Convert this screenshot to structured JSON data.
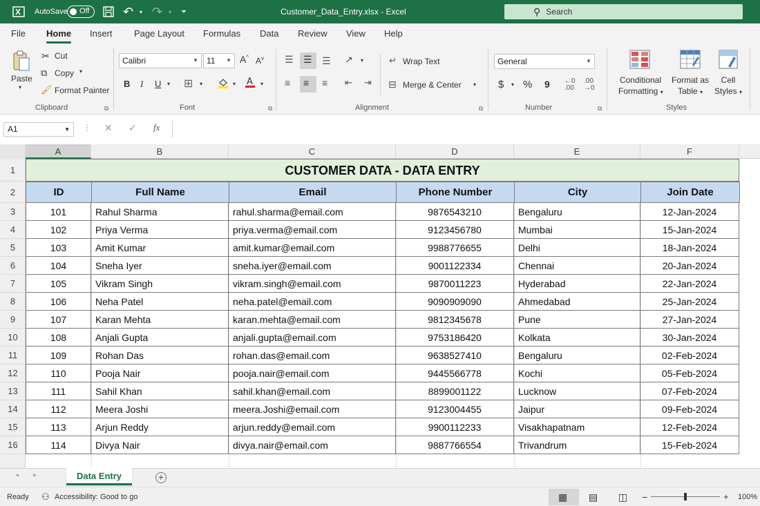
{
  "titlebar": {
    "autosave_label": "AutoSave",
    "autosave_state": "Off",
    "file_title": "Customer_Data_Entry.xlsx  -  Excel",
    "search_placeholder": "Search"
  },
  "ribbon_tabs": [
    "File",
    "Home",
    "Insert",
    "Page Layout",
    "Formulas",
    "Data",
    "Review",
    "View",
    "Help"
  ],
  "ribbon": {
    "clipboard": {
      "paste": "Paste",
      "cut": "Cut",
      "copy": "Copy",
      "format_painter": "Format Painter",
      "label": "Clipboard"
    },
    "font": {
      "name": "Calibri",
      "size": "11",
      "bold": "B",
      "italic": "I",
      "underline": "U",
      "label": "Font"
    },
    "alignment": {
      "wrap_text": "Wrap Text",
      "merge_center": "Merge & Center",
      "label": "Alignment"
    },
    "number": {
      "format": "General",
      "currency": "$",
      "percent": "%",
      "comma": "9",
      "label": "Number"
    },
    "styles": {
      "conditional": [
        "Conditional",
        "Formatting"
      ],
      "format_table": [
        "Format as",
        "Table"
      ],
      "cell_styles": [
        "Cell",
        "Styles"
      ],
      "label": "Styles"
    }
  },
  "formula_bar": {
    "name_box": "A1",
    "fx": "fx",
    "formula": ""
  },
  "columns": [
    "A",
    "B",
    "C",
    "D",
    "E",
    "F"
  ],
  "row_numbers": [
    "1",
    "2",
    "3",
    "4",
    "5",
    "6",
    "7",
    "8",
    "9",
    "10",
    "11",
    "12",
    "13",
    "14",
    "15",
    "16"
  ],
  "sheet": {
    "title": "CUSTOMER DATA - DATA ENTRY",
    "headers": [
      "ID",
      "Full Name",
      "Email",
      "Phone Number",
      "City",
      "Join Date"
    ],
    "rows": [
      [
        "101",
        "Rahul Sharma",
        "rahul.sharma@email.com",
        "9876543210",
        "Bengaluru",
        "12-Jan-2024"
      ],
      [
        "102",
        "Priya Verma",
        "priya.verma@email.com",
        "9123456780",
        "Mumbai",
        "15-Jan-2024"
      ],
      [
        "103",
        "Amit Kumar",
        "amit.kumar@email.com",
        "9988776655",
        "Delhi",
        "18-Jan-2024"
      ],
      [
        "104",
        "Sneha Iyer",
        "sneha.iyer@email.com",
        "9001122334",
        "Chennai",
        "20-Jan-2024"
      ],
      [
        "105",
        "Vikram Singh",
        "vikram.singh@email.com",
        "9870011223",
        "Hyderabad",
        "22-Jan-2024"
      ],
      [
        "106",
        "Neha Patel",
        "neha.patel@email.com",
        "9090909090",
        "Ahmedabad",
        "25-Jan-2024"
      ],
      [
        "107",
        "Karan Mehta",
        "karan.mehta@email.com",
        "9812345678",
        "Pune",
        "27-Jan-2024"
      ],
      [
        "108",
        "Anjali Gupta",
        "anjali.gupta@email.com",
        "9753186420",
        "Kolkata",
        "30-Jan-2024"
      ],
      [
        "109",
        "Rohan Das",
        "rohan.das@email.com",
        "9638527410",
        "Bengaluru",
        "02-Feb-2024"
      ],
      [
        "110",
        "Pooja Nair",
        "pooja.nair@email.com",
        "9445566778",
        "Kochi",
        "05-Feb-2024"
      ],
      [
        "111",
        "Sahil Khan",
        "sahil.khan@email.com",
        "8899001122",
        "Lucknow",
        "07-Feb-2024"
      ],
      [
        "112",
        "Meera Joshi",
        "meera.Joshi@email.com",
        "9123004455",
        "Jaipur",
        "09-Feb-2024"
      ],
      [
        "113",
        "Arjun Reddy",
        "arjun.reddy@email.com",
        "9900112233",
        "Visakhapatnam",
        "12-Feb-2024"
      ],
      [
        "114",
        "Divya Nair",
        "divya.nair@email.com",
        "9887766554",
        "Trivandrum",
        "15-Feb-2024"
      ]
    ]
  },
  "sheet_tabs": {
    "active": "Data Entry",
    "add": "+"
  },
  "statusbar": {
    "ready": "Ready",
    "accessibility": "Accessibility: Good to go",
    "zoom": "100%"
  },
  "colors": {
    "brand": "#1e7145",
    "title_fill": "#e2efda",
    "header_fill": "#c5d9f1"
  }
}
